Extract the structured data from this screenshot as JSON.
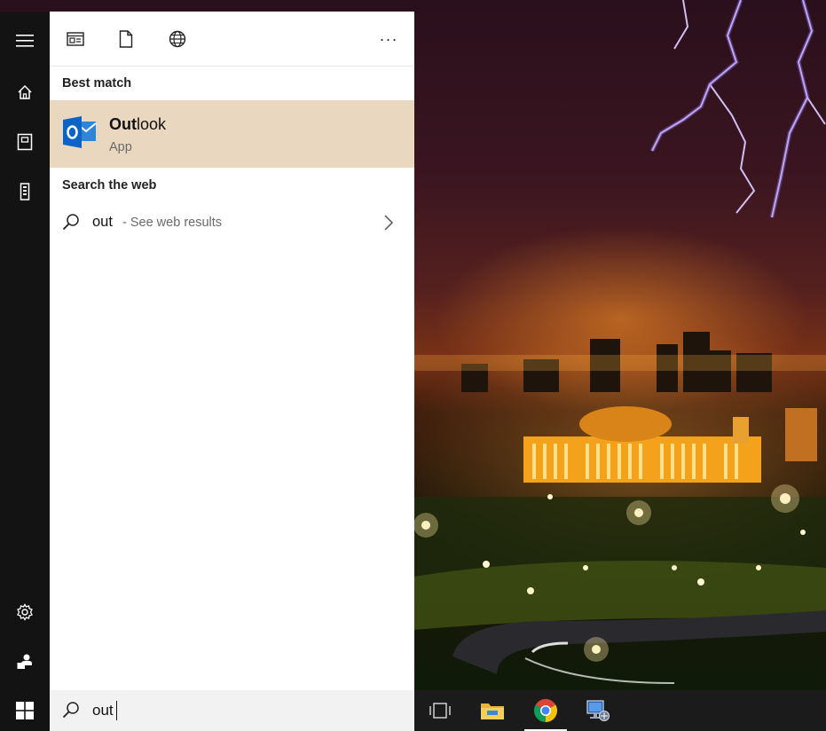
{
  "rail": {
    "items": [
      {
        "icon": "hamburger-menu-icon"
      },
      {
        "icon": "home-icon"
      },
      {
        "icon": "documents-icon"
      },
      {
        "icon": "device-icon"
      },
      {
        "icon": "settings-gear-icon"
      },
      {
        "icon": "feedback-icon"
      }
    ]
  },
  "panel": {
    "top_tabs": [
      {
        "icon": "apps-filter-icon"
      },
      {
        "icon": "documents-filter-icon"
      },
      {
        "icon": "web-filter-icon"
      }
    ],
    "more_label": "···",
    "best_match": {
      "title": "Best match",
      "app_name_bold": "Out",
      "app_name_rest": "look",
      "app_type": "App"
    },
    "web": {
      "title": "Search the web",
      "query": "out",
      "hint": "- See web results"
    }
  },
  "search": {
    "value": "out"
  },
  "taskbar": {
    "items": [
      {
        "icon": "task-view-icon"
      },
      {
        "icon": "file-explorer-icon"
      },
      {
        "icon": "chrome-icon",
        "active": true
      },
      {
        "icon": "network-computer-icon"
      }
    ]
  },
  "colors": {
    "rail_bg": "#131313",
    "highlight_bg": "#ead7bf",
    "outlook_blue": "#0a64c8"
  }
}
